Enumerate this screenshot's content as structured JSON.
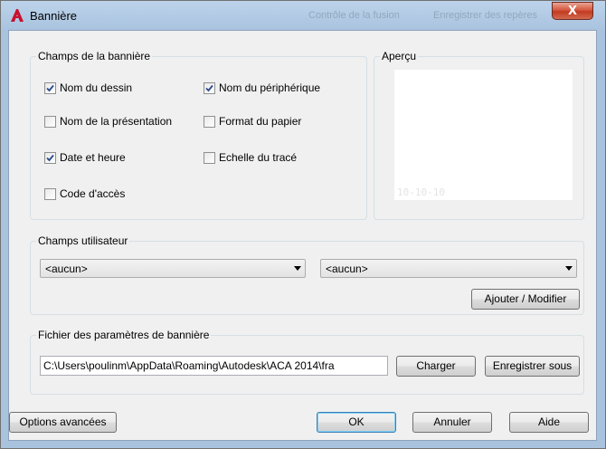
{
  "window": {
    "title": "Bannière",
    "close_glyph": "X",
    "ghost_left": "Contrôle de la fusion",
    "ghost_right": "Enregistrer des repères"
  },
  "banner_fields": {
    "title": "Champs de la bannière",
    "items": [
      {
        "label": "Nom du dessin",
        "checked": true
      },
      {
        "label": "Nom du périphérique",
        "checked": true
      },
      {
        "label": "Nom de la présentation",
        "checked": false
      },
      {
        "label": "Format du papier",
        "checked": false
      },
      {
        "label": "Date et heure",
        "checked": true
      },
      {
        "label": "Echelle du tracé",
        "checked": false
      },
      {
        "label": "Code d'accès",
        "checked": false
      }
    ]
  },
  "preview": {
    "title": "Aperçu",
    "sample_text": "10-10-10"
  },
  "user_fields": {
    "title": "Champs utilisateur",
    "select_left": "<aucun>",
    "select_right": "<aucun>",
    "add_modify_label": "Ajouter / Modifier"
  },
  "settings_file": {
    "title": "Fichier des paramètres de bannière",
    "path_value": "C:\\Users\\poulinm\\AppData\\Roaming\\Autodesk\\ACA 2014\\fra",
    "load_label": "Charger",
    "save_as_label": "Enregistrer sous"
  },
  "footer": {
    "advanced_label": "Options avancées",
    "ok_label": "OK",
    "cancel_label": "Annuler",
    "help_label": "Aide"
  },
  "icons": {
    "app": "autocad-a-icon",
    "check": "checkmark-icon",
    "dropdown": "chevron-down-icon"
  },
  "colors": {
    "app_icon": "#c8102e",
    "check": "#2a4a8c",
    "close_button": "#c23a20"
  }
}
